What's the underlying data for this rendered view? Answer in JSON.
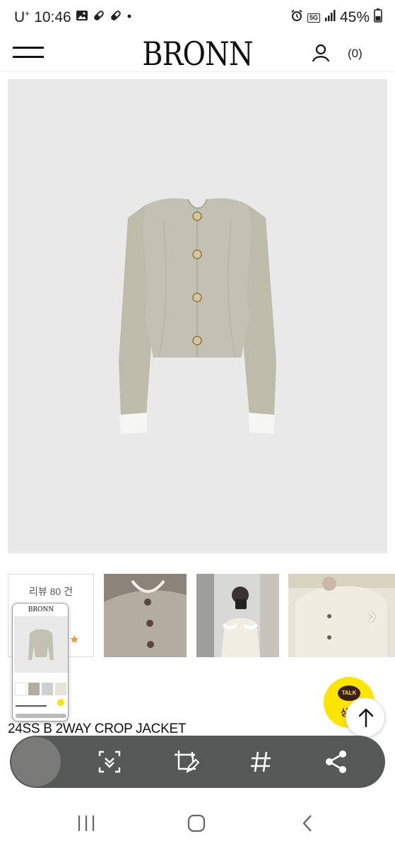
{
  "status_bar": {
    "carrier": "U",
    "carrier_sup": "+",
    "time": "10:46",
    "network": "5G",
    "battery": "45%",
    "left_icons": [
      "gallery-icon",
      "capsule-icon",
      "capsule-icon",
      "dot-icon"
    ],
    "right_icons": [
      "alarm-icon",
      "network-5g-icon",
      "signal-icon",
      "battery-icon"
    ]
  },
  "header": {
    "logo": "BRONN",
    "cart_count": "(0)",
    "icons": [
      "hamburger-menu-icon",
      "user-icon"
    ]
  },
  "thumbnails": {
    "review_label": "리뷰 80 건",
    "review_star": "★",
    "next_arrow": "›"
  },
  "preview": {
    "logo": "BRONN"
  },
  "product": {
    "name": "24SS B 2WAY CROP JACKET"
  },
  "kakao": {
    "bubble": "TALK",
    "label": "상담"
  },
  "capture_toolbar": {
    "icons": [
      "scroll-capture-icon",
      "edit-crop-icon",
      "hashtag-icon",
      "share-icon"
    ]
  },
  "navbar": {
    "icons": [
      "recent-apps-icon",
      "home-icon",
      "back-icon"
    ]
  },
  "colors": {
    "kakao": "#fee500",
    "toolbar": "#555857",
    "image_bg": "#e9e9ea",
    "review_star": "#f1962e"
  }
}
